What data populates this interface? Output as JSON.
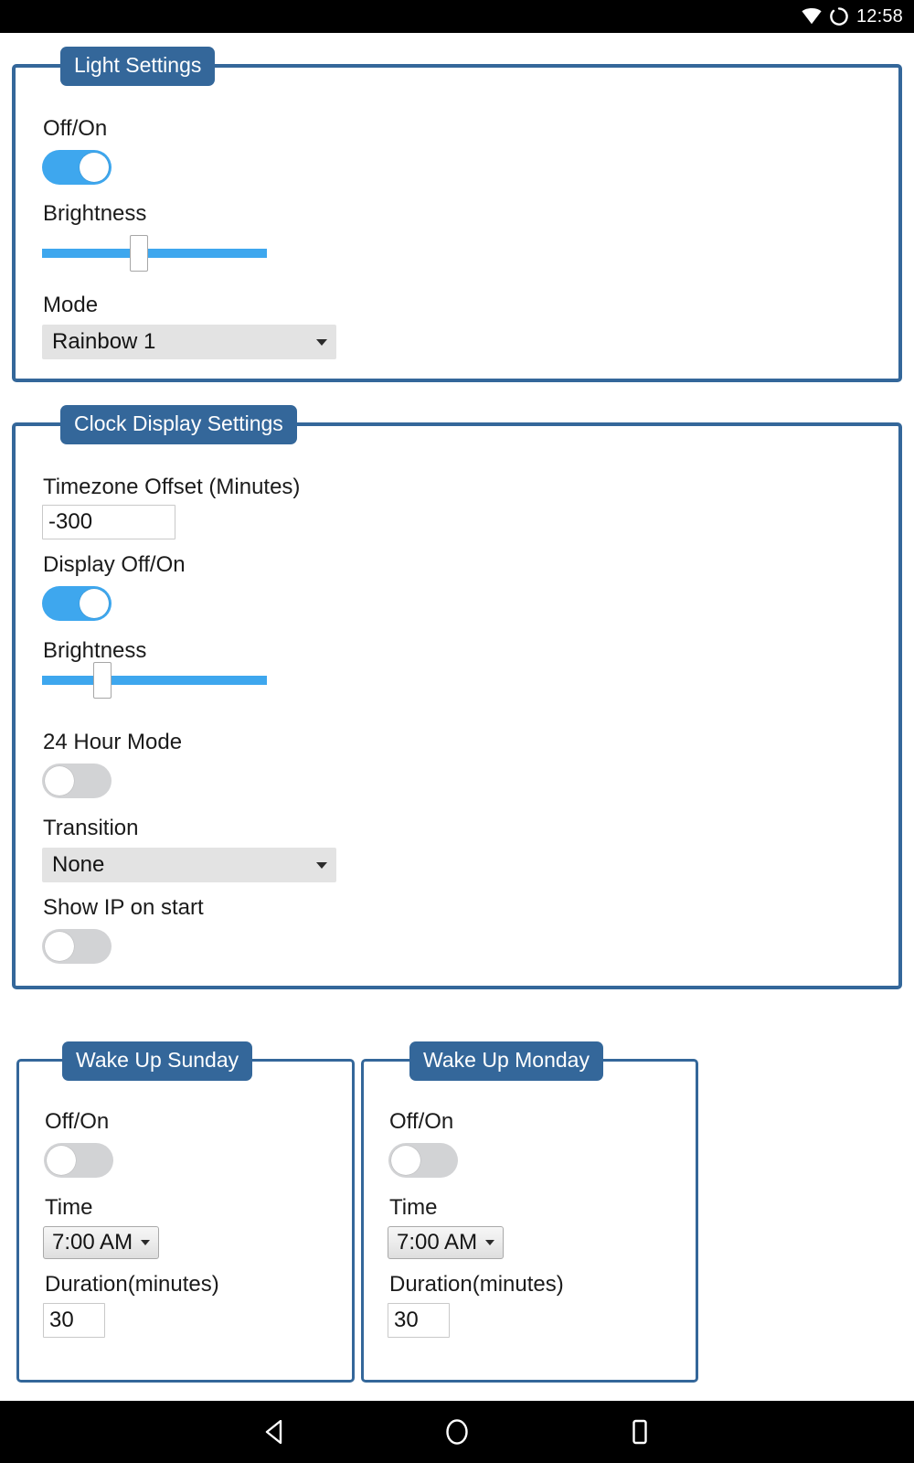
{
  "statusbar": {
    "time": "12:58",
    "wifi_icon": "wifi-icon",
    "sync_icon": "sync-circle-icon"
  },
  "navbar": {
    "back_icon": "back-triangle-icon",
    "home_icon": "home-circle-icon",
    "recents_icon": "recents-square-icon"
  },
  "colors": {
    "panel_border": "#34679A",
    "legend_background": "#34679A",
    "toggle_on": "#3ea7ee",
    "toggle_off": "#d2d3d5",
    "slider_track": "#3ea7ee",
    "select_background": "#e3e3e3",
    "statusbar_background": "#000000"
  },
  "light_settings": {
    "legend": "Light Settings",
    "onoff_label": "Off/On",
    "onoff_state": "on",
    "brightness_label": "Brightness",
    "brightness_percent": 43,
    "mode_label": "Mode",
    "mode_value": "Rainbow 1",
    "mode_options": [
      "Rainbow 1"
    ]
  },
  "clock_display_settings": {
    "legend": "Clock Display Settings",
    "timezone_label": "Timezone Offset (Minutes)",
    "timezone_value": "-300",
    "display_onoff_label": "Display Off/On",
    "display_onoff_state": "on",
    "brightness_label": "Brightness",
    "brightness_percent": 27,
    "hour24_label": "24 Hour Mode",
    "hour24_state": "off",
    "transition_label": "Transition",
    "transition_value": "None",
    "transition_options": [
      "None"
    ],
    "show_ip_label": "Show IP on start",
    "show_ip_state": "off"
  },
  "wake_up_sunday": {
    "legend": "Wake Up Sunday",
    "onoff_label": "Off/On",
    "onoff_state": "off",
    "time_label": "Time",
    "time_value": "7:00 AM",
    "duration_label": "Duration(minutes)",
    "duration_value": "30"
  },
  "wake_up_monday": {
    "legend": "Wake Up Monday",
    "onoff_label": "Off/On",
    "onoff_state": "off",
    "time_label": "Time",
    "time_value": "7:00 AM",
    "duration_label": "Duration(minutes)",
    "duration_value": "30"
  }
}
